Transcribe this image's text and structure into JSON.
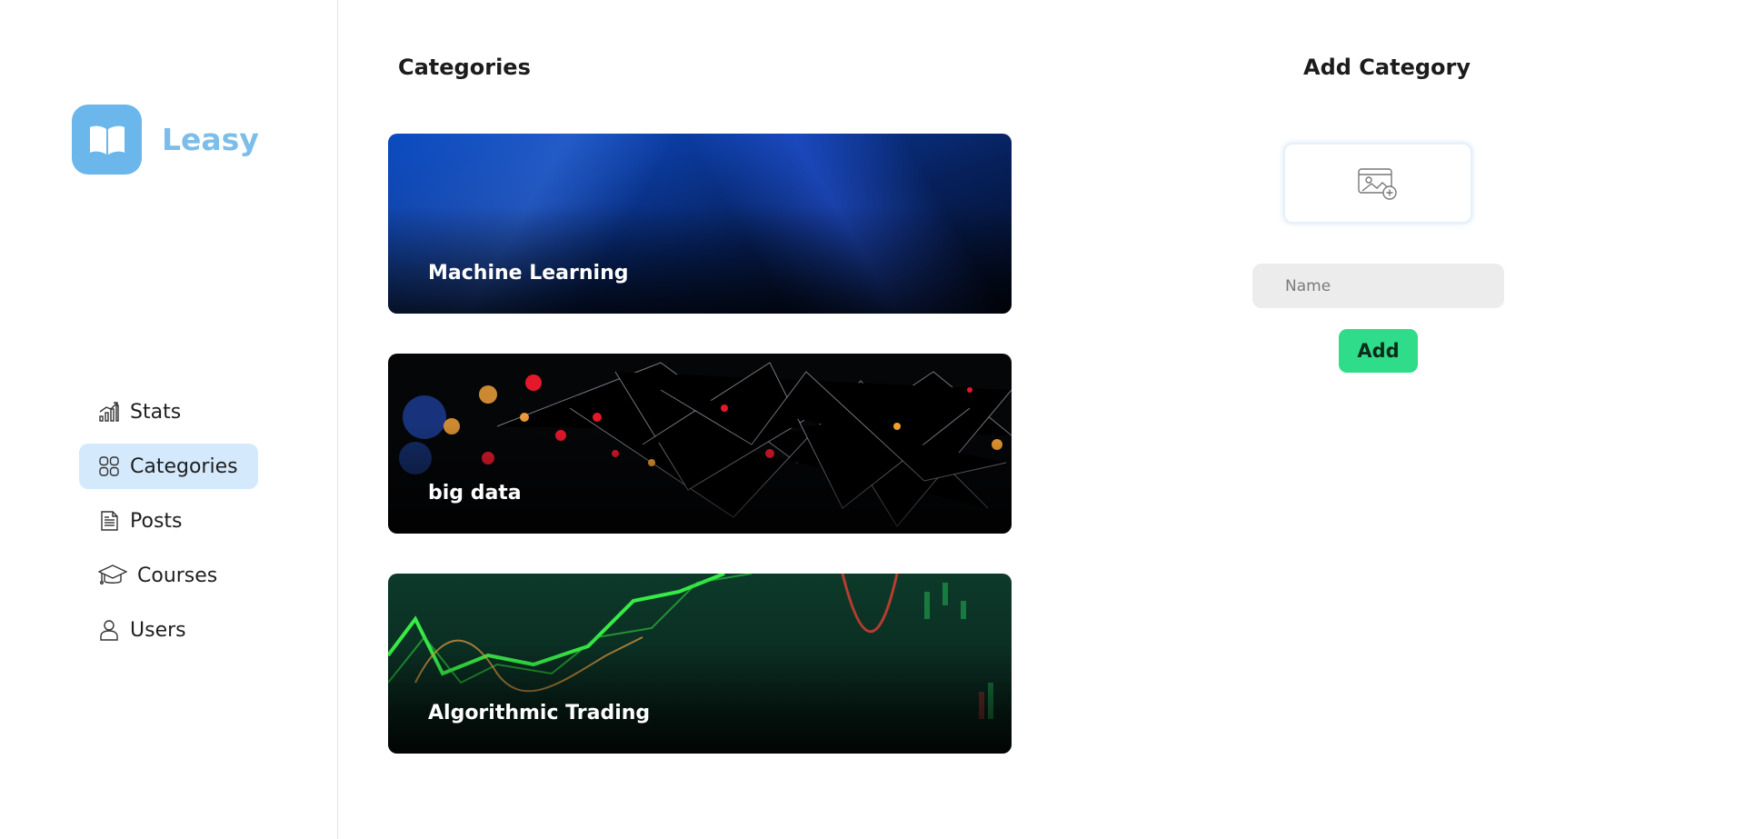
{
  "brand": {
    "name": "Leasy"
  },
  "sidebar": {
    "items": [
      {
        "label": "Stats",
        "icon": "stats-icon",
        "active": false
      },
      {
        "label": "Categories",
        "icon": "grid-icon",
        "active": true
      },
      {
        "label": "Posts",
        "icon": "document-icon",
        "active": false
      },
      {
        "label": "Courses",
        "icon": "graduation-cap-icon",
        "active": false
      },
      {
        "label": "Users",
        "icon": "user-icon",
        "active": false
      }
    ]
  },
  "main": {
    "title": "Categories",
    "categories": [
      {
        "name": "Machine Learning"
      },
      {
        "name": "big data"
      },
      {
        "name": "Algorithmic Trading"
      }
    ]
  },
  "add_panel": {
    "title": "Add Category",
    "name_placeholder": "Name",
    "add_label": "Add"
  },
  "colors": {
    "accent": "#6bb7ec",
    "active_nav_bg": "#d4e9fb",
    "add_button": "#2fdc8a"
  }
}
